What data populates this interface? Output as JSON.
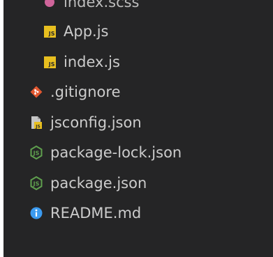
{
  "colors": {
    "panel_bg": "#252526",
    "text": "#cccccc",
    "js_yellow": "#e8bf1f",
    "git_orange": "#e2572f",
    "node_green": "#5fa04e",
    "info_blue": "#3b9bf0",
    "sass_pink": "#cf649a"
  },
  "explorer": {
    "items": [
      {
        "label": "index.scss",
        "icon": "sass-icon"
      },
      {
        "label": "App.js",
        "icon": "js-icon"
      },
      {
        "label": "index.js",
        "icon": "js-icon"
      },
      {
        "label": ".gitignore",
        "icon": "git-icon"
      },
      {
        "label": "jsconfig.json",
        "icon": "jsconfig-icon"
      },
      {
        "label": "package-lock.json",
        "icon": "nodejs-icon"
      },
      {
        "label": "package.json",
        "icon": "nodejs-icon"
      },
      {
        "label": "README.md",
        "icon": "info-icon"
      }
    ]
  }
}
